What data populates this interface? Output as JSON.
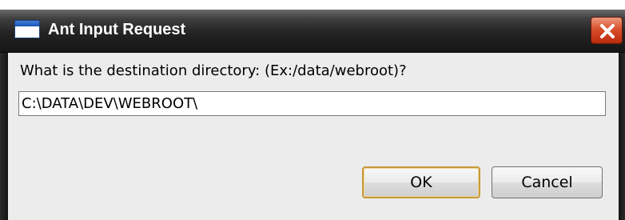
{
  "window": {
    "title": "Ant Input Request",
    "close_icon": "close-x-icon",
    "title_icon": "window-icon"
  },
  "form": {
    "prompt": "What is the destination directory: (Ex:/data/webroot)?",
    "input_value": "C:\\DATA\\DEV\\WEBROOT\\"
  },
  "buttons": {
    "ok_label": "OK",
    "cancel_label": "Cancel"
  },
  "colors": {
    "titlebar": "#1e1e1e",
    "close_button": "#d9502c",
    "client_bg": "#ececec",
    "default_button_border": "#c79a3a"
  }
}
